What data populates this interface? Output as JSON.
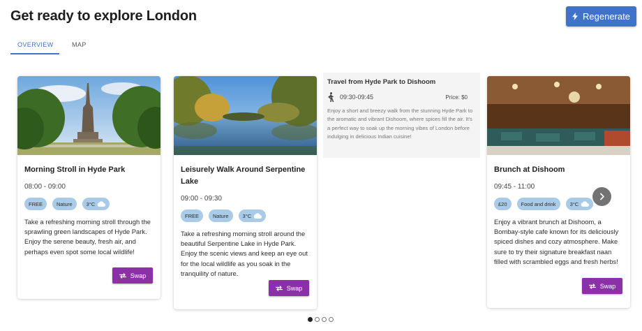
{
  "header": {
    "title": "Get ready to explore London",
    "regenerate_label": "Regenerate"
  },
  "tabs": [
    {
      "label": "OVERVIEW",
      "active": true
    },
    {
      "label": "MAP",
      "active": false
    }
  ],
  "cards": [
    {
      "title": "Morning Stroll in Hyde Park",
      "time": "08:00 - 09:00",
      "chips": [
        "FREE",
        "Nature",
        "3°C"
      ],
      "description": "Take a refreshing morning stroll through the sprawling green landscapes of Hyde Park. Enjoy the serene beauty, fresh air, and perhaps even spot some local wildlife!",
      "swap_label": "Swap"
    },
    {
      "title": "Leisurely Walk Around Serpentine Lake",
      "time": "09:00 - 09:30",
      "chips": [
        "FREE",
        "Nature",
        "3°C"
      ],
      "description": "Take a refreshing morning stroll around the beautiful Serpentine Lake in Hyde Park. Enjoy the scenic views and keep an eye out for the local wildlife as you soak in the tranquility of nature.",
      "swap_label": "Swap"
    },
    {
      "title": "Brunch at Dishoom",
      "time": "09:45 - 11:00",
      "chips": [
        "£20",
        "Food and drink",
        "3°C"
      ],
      "description": "Enjoy a vibrant brunch at Dishoom, a Bombay-style cafe known for its deliciously spiced dishes and cozy atmosphere. Make sure to try their signature breakfast naan filled with scrambled eggs and fresh herbs!",
      "swap_label": "Swap"
    }
  ],
  "travel": {
    "title": "Travel from Hyde Park to Dishoom",
    "time": "09:30-09:45",
    "price": "Price: $0",
    "description": "Enjoy a short and breezy walk from the stunning Hyde Park to the aromatic and vibrant Dishoom, where spices fill the air. It's a perfect way to soak up the morning vibes of London before indulging in delicious Indian cuisine!"
  },
  "icons": {
    "regenerate": "bolt-icon",
    "weather": "cloud-icon",
    "swap": "swap-arrows-icon",
    "travel": "walking-person-icon",
    "next": "chevron-right-icon"
  },
  "colors": {
    "accent": "#3f73c9",
    "swap_button": "#8a31a8",
    "chip": "#a9cbe8"
  },
  "carousel": {
    "pages": 4,
    "current": 1
  }
}
